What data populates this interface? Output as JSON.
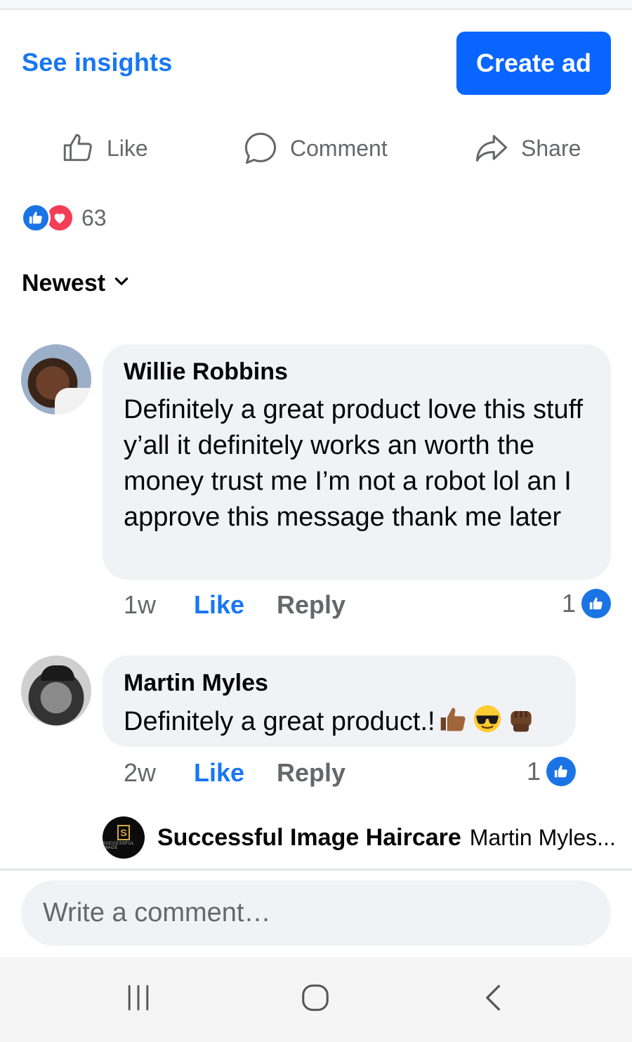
{
  "header": {
    "insights_link": "See insights",
    "create_ad_button": "Create ad"
  },
  "actions": {
    "like": "Like",
    "comment": "Comment",
    "share": "Share"
  },
  "reactions": {
    "count": "63",
    "types": [
      "like",
      "love"
    ]
  },
  "sort": {
    "label": "Newest"
  },
  "comments": [
    {
      "author": "Willie Robbins",
      "text": "Definitely a great product love this stuff y’all it definitely works an worth the money trust me I’m not a robot lol an I approve this message thank me later",
      "time": "1w",
      "like_label": "Like",
      "reply_label": "Reply",
      "reaction_count": "1"
    },
    {
      "author": "Martin Myles",
      "text": "Definitely a great product.!",
      "emojis": [
        "thumbs-up-medium-dark-skin",
        "smiling-face-with-sunglasses",
        "raised-fist-dark-skin"
      ],
      "time": "2w",
      "like_label": "Like",
      "reply_label": "Reply",
      "reaction_count": "1"
    }
  ],
  "reply_preview": {
    "author": "Successful Image Haircare",
    "snippet": "Martin Myles...",
    "logo_letter": "S",
    "logo_text": "SUCCESSFUL IMAGE"
  },
  "composer": {
    "placeholder": "Write a comment…"
  },
  "colors": {
    "brand_blue": "#1877f2",
    "button_blue": "#0866ff",
    "bubble_gray": "#f0f2f5",
    "secondary_text": "#65676b",
    "love_red": "#f33e58"
  }
}
